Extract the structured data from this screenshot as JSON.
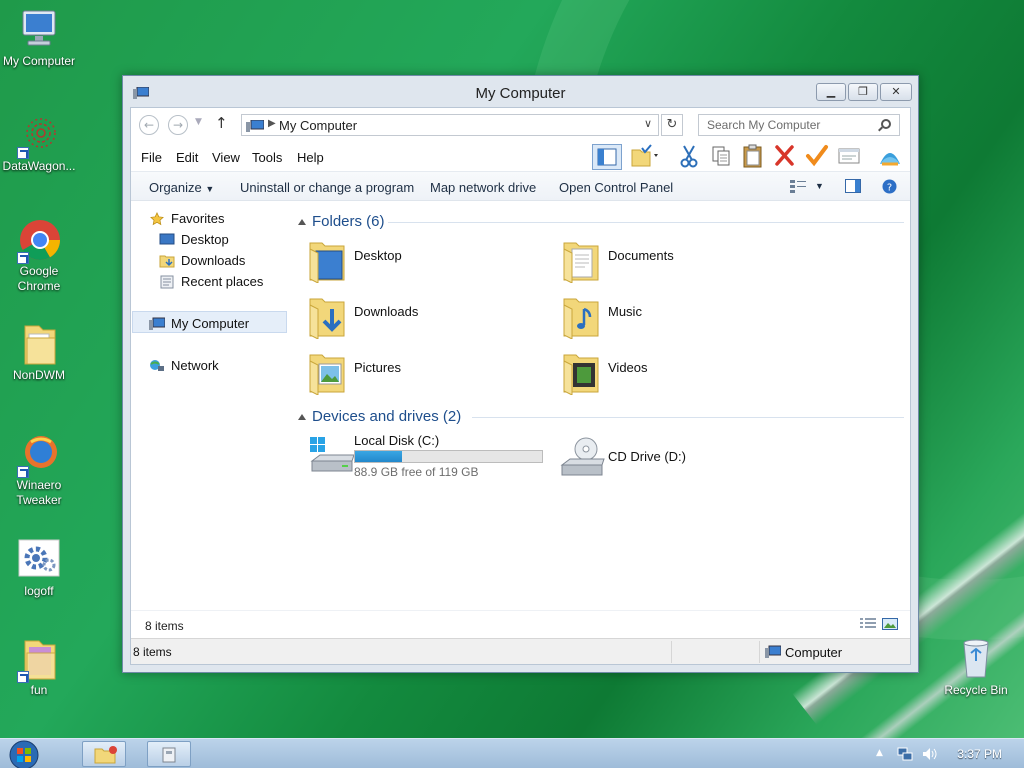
{
  "desktop": {
    "icons": [
      {
        "label": "My Computer"
      },
      {
        "label": "DataWagon..."
      },
      {
        "label": "Google Chrome"
      },
      {
        "label": "NonDWM"
      },
      {
        "label": "Winaero Tweaker"
      },
      {
        "label": "logoff"
      },
      {
        "label": "fun"
      },
      {
        "label": "Recycle Bin"
      }
    ]
  },
  "window": {
    "title": "My Computer",
    "address": "My Computer",
    "search_placeholder": "Search My Computer",
    "menu": [
      "File",
      "Edit",
      "View",
      "Tools",
      "Help"
    ],
    "commands": {
      "organize": "Organize",
      "uninstall": "Uninstall or change a program",
      "map_drive": "Map network drive",
      "control_panel": "Open Control Panel"
    },
    "nav": {
      "favorites": "Favorites",
      "desktop": "Desktop",
      "downloads": "Downloads",
      "recent": "Recent places",
      "my_computer": "My Computer",
      "network": "Network"
    },
    "folders_header": "Folders (6)",
    "folders": [
      "Desktop",
      "Documents",
      "Downloads",
      "Music",
      "Pictures",
      "Videos"
    ],
    "devices_header": "Devices and drives (2)",
    "drives": [
      {
        "name": "Local Disk (C:)",
        "free": "88.9 GB free of 119 GB",
        "used_fraction": 0.253
      },
      {
        "name": "CD Drive (D:)"
      }
    ],
    "details_count": "8 items",
    "status_count": "8 items",
    "status_location": "Computer"
  },
  "taskbar": {
    "clock": "3:37 PM"
  },
  "colors": {
    "accent": "#1e4e8c",
    "drive_fill": "#2a93d6",
    "wallpaper": "#1f9a4a"
  }
}
